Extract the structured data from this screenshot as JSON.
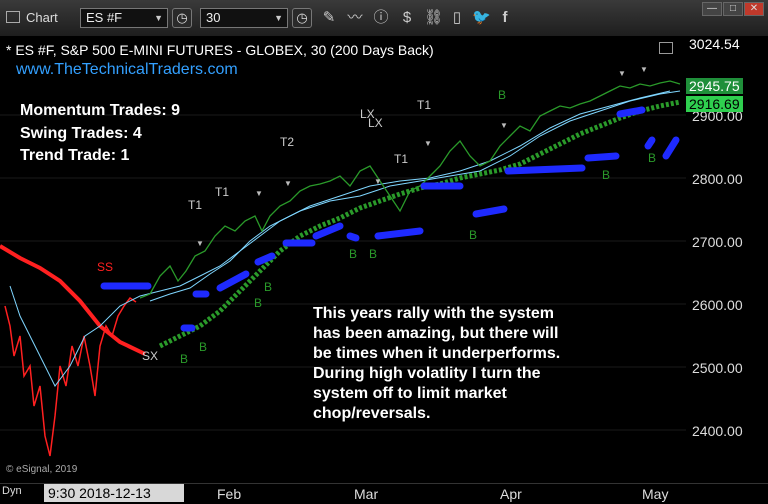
{
  "toolbar": {
    "title": "Chart",
    "symbol": "ES #F",
    "interval": "30",
    "icons": [
      "chart-icon",
      "clock-icon",
      "clock-icon",
      "pencil-icon",
      "line-tool-icon",
      "info-icon",
      "dollar-icon",
      "link-icon",
      "page-icon",
      "twitter-icon",
      "facebook-icon"
    ]
  },
  "chart": {
    "title": "* ES #F, S&P 500 E-MINI FUTURES - GLOBEX, 30 (200 Days Back)",
    "website": "www.TheTechnicalTraders.com",
    "stats": [
      "Momentum Trades: 9",
      "Swing Trades: 4",
      "Trend Trade: 1"
    ],
    "annotation": [
      "This years rally with the system",
      "has been amazing, but there will",
      "be times when it underperforms.",
      "During high volatlity I turn the",
      "system off to limit market",
      "chop/reversals."
    ],
    "copyright": "© eSignal, 2019"
  },
  "axis": {
    "y_labels": [
      "3024.54",
      "2900.00",
      "2800.00",
      "2700.00",
      "2600.00",
      "2500.00",
      "2400.00"
    ],
    "price_high": "2945.75",
    "price_low": "2916.69",
    "x_labels": [
      "Feb",
      "Mar",
      "Apr",
      "May"
    ]
  },
  "footer": {
    "dyn": "Dyn",
    "date": "9:30 2018-12-13"
  },
  "signals": [
    {
      "label": "SS",
      "color": "#ff2020"
    },
    {
      "label": "SX",
      "color": "#cccccc"
    },
    {
      "label": "T1",
      "color": "#cccccc"
    },
    {
      "label": "T2",
      "color": "#cccccc"
    },
    {
      "label": "T1",
      "color": "#cccccc"
    },
    {
      "label": "LX",
      "color": "#cccccc"
    },
    {
      "label": "LX",
      "color": "#cccccc"
    },
    {
      "label": "T1",
      "color": "#cccccc"
    },
    {
      "label": "T1",
      "color": "#cccccc"
    },
    {
      "label": "B",
      "color": "#2a9a2a"
    },
    {
      "label": "B",
      "color": "#2a9a2a"
    },
    {
      "label": "B",
      "color": "#2a9a2a"
    },
    {
      "label": "B",
      "color": "#2a9a2a"
    },
    {
      "label": "B",
      "color": "#2a9a2a"
    },
    {
      "label": "B",
      "color": "#2a9a2a"
    },
    {
      "label": "B",
      "color": "#2a9a2a"
    },
    {
      "label": "B",
      "color": "#2a9a2a"
    },
    {
      "label": "B",
      "color": "#2a9a2a"
    },
    {
      "label": "B",
      "color": "#2a9a2a"
    }
  ],
  "colors": {
    "price_up": "#2a9a2a",
    "price_down": "#ff2020",
    "stop": "#1e2aff",
    "ma": "#2a9a2a",
    "channel": "#7fd6ff",
    "website": "#33a0ff"
  }
}
